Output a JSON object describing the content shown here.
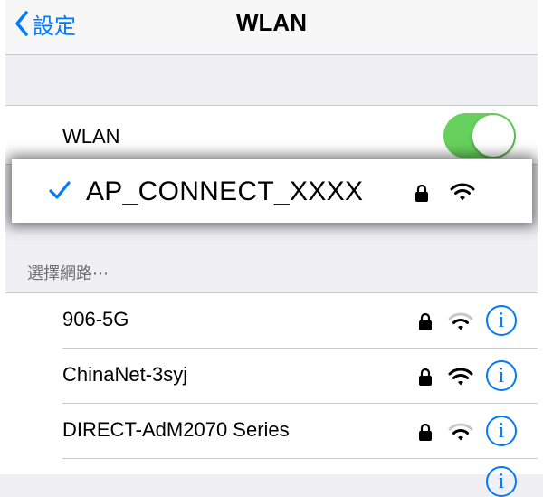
{
  "nav": {
    "back_label": "設定",
    "title": "WLAN"
  },
  "wlan_toggle": {
    "label": "WLAN",
    "state": "on",
    "color": "#67d15d"
  },
  "current_network": {
    "ssid": "AP_CONNECT_XXXX",
    "secured": true,
    "signal": "full",
    "icons": [
      "checkmark-icon",
      "lock-icon",
      "wifi-icon"
    ]
  },
  "networks_section": {
    "header": "選擇網路⋯"
  },
  "networks": [
    {
      "ssid": "906-5G",
      "secured": true,
      "signal": "medium"
    },
    {
      "ssid": "ChinaNet-3syj",
      "secured": true,
      "signal": "full"
    },
    {
      "ssid": "DIRECT-AdM2070 Series",
      "secured": true,
      "signal": "medium"
    }
  ],
  "colors": {
    "accent": "#007aff",
    "toggle_on": "#67d15d",
    "background": "#efeff4"
  }
}
